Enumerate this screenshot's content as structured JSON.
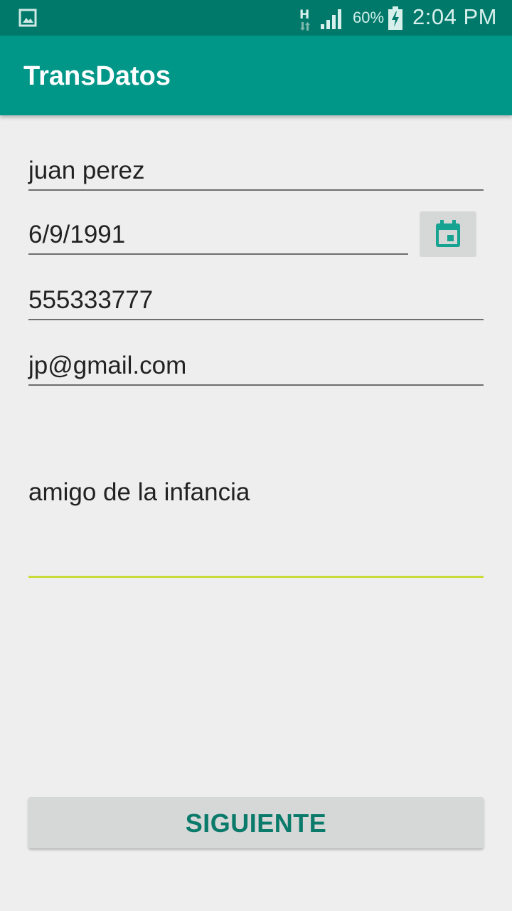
{
  "status_bar": {
    "battery_percent": "60%",
    "time": "2:04 PM",
    "network_type": "H",
    "icons": [
      "image-notification-icon",
      "h-data-icon",
      "signal-icon",
      "battery-charging-icon"
    ]
  },
  "app_bar": {
    "title": "TransDatos",
    "color": "#009688"
  },
  "form": {
    "name": "juan perez",
    "birth_date": "6/9/1991",
    "phone": "555333777",
    "email": "jp@gmail.com",
    "notes": "amigo de la infancia"
  },
  "date_picker": {
    "icon": "calendar-icon",
    "icon_color": "#17a391"
  },
  "next_button": {
    "label": "SIGUIENTE",
    "color": "#0a7a6a"
  },
  "colors": {
    "status_bar": "#00796b",
    "background": "#eeeeee",
    "focus_underline": "#c9dc37"
  }
}
